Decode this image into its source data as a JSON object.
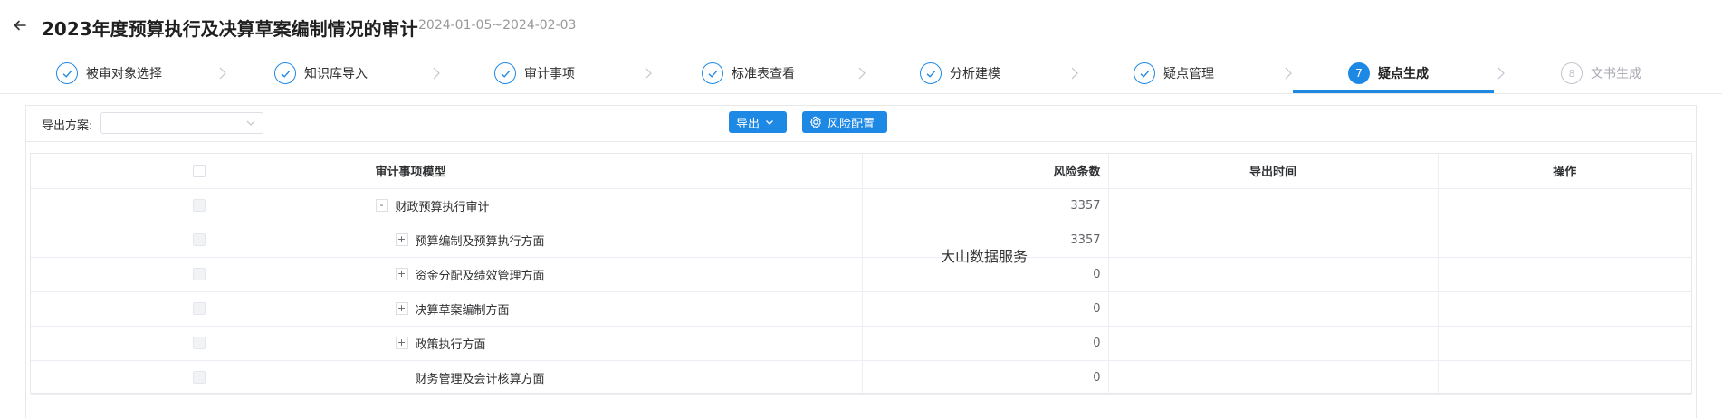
{
  "header": {
    "title": "2023年度预算执行及决算草案编制情况的审计",
    "date_range": "2024-01-05~2024-02-03"
  },
  "steps": [
    {
      "label": "被审对象选择",
      "status": "done"
    },
    {
      "label": "知识库导入",
      "status": "done"
    },
    {
      "label": "审计事项",
      "status": "done"
    },
    {
      "label": "标准表查看",
      "status": "done"
    },
    {
      "label": "分析建模",
      "status": "done"
    },
    {
      "label": "疑点管理",
      "status": "done"
    },
    {
      "label": "疑点生成",
      "status": "active",
      "number": "7"
    },
    {
      "label": "文书生成",
      "status": "pending",
      "number": "8"
    }
  ],
  "toolbar": {
    "export_scheme_label": "导出方案:",
    "export_scheme_value": "",
    "export_button": "导出",
    "risk_config_button": "风险配置"
  },
  "table": {
    "columns": {
      "model": "审计事项模型",
      "risk_count": "风险条数",
      "export_time": "导出时间",
      "operation": "操作"
    },
    "rows": [
      {
        "toggle": "-",
        "model": "财政预算执行审计",
        "risk_count": "3357",
        "export_time": "",
        "operation": ""
      },
      {
        "toggle": "+",
        "model": "预算编制及预算执行方面",
        "risk_count": "3357",
        "export_time": "",
        "operation": ""
      },
      {
        "toggle": "+",
        "model": "资金分配及绩效管理方面",
        "risk_count": "0",
        "export_time": "",
        "operation": ""
      },
      {
        "toggle": "+",
        "model": "决算草案编制方面",
        "risk_count": "0",
        "export_time": "",
        "operation": ""
      },
      {
        "toggle": "+",
        "model": "政策执行方面",
        "risk_count": "0",
        "export_time": "",
        "operation": ""
      },
      {
        "toggle": "",
        "model": "财务管理及会计核算方面",
        "risk_count": "0",
        "export_time": "",
        "operation": ""
      }
    ]
  },
  "watermark": "大山数据服务",
  "colors": {
    "primary": "#1e88e5",
    "border": "#e8e8e8",
    "text": "#303133",
    "muted": "#999999"
  }
}
